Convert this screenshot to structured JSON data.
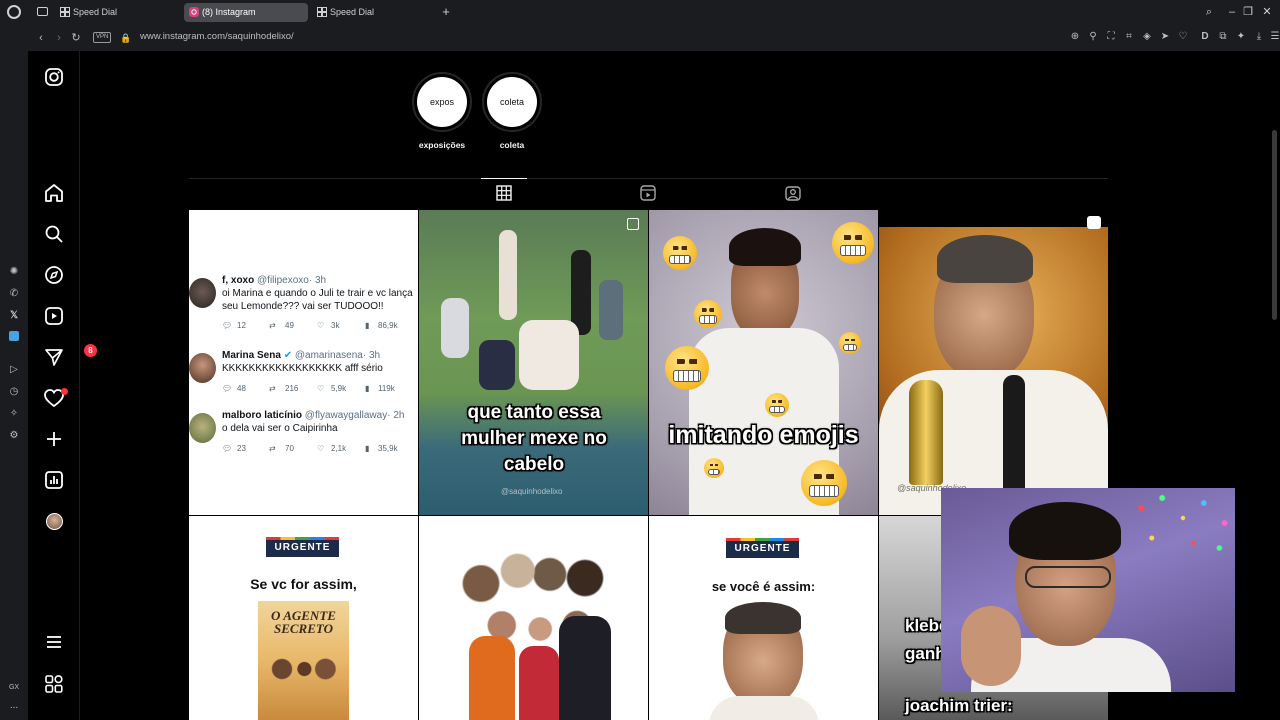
{
  "browser": {
    "tabs": [
      {
        "label": "Speed Dial",
        "active": false
      },
      {
        "label": "(8) Instagram",
        "active": true
      },
      {
        "label": "Speed Dial",
        "active": false
      }
    ],
    "new_tab": "+",
    "url": "www.instagram.com/saquinhodelixo/",
    "vpn_label": "VPN",
    "gx_label": "GX",
    "more_label": "...",
    "accent": "#d0447f"
  },
  "instagram": {
    "nav_badge": "8",
    "highlights": [
      {
        "label": "exposições",
        "cover": "expos"
      },
      {
        "label": "coleta",
        "cover": "coleta"
      }
    ],
    "posts": {
      "tweets": [
        {
          "name": "f, xoxo",
          "handle": "@filipexoxo",
          "time": "· 3h",
          "text": "oi Marina e quando o Juli te trair e vc lança seu Lemonde??? vai ser TUDOOO!!",
          "replies": "12",
          "retweets": "49",
          "likes": "3k",
          "views": "86,9k"
        },
        {
          "name": "Marina Sena",
          "handle": "@amarinasena",
          "time": "· 3h",
          "text": "KKKKKKKKKKKKKKKKKK afff sério",
          "replies": "48",
          "retweets": "216",
          "likes": "5,9k",
          "views": "119k"
        },
        {
          "name": "malboro laticínio",
          "handle": "@flyawaygallaway",
          "time": "· 2h",
          "text": "o dela vai ser o Caipirinha",
          "replies": "23",
          "retweets": "70",
          "likes": "2,1k",
          "views": "35,9k"
        }
      ],
      "post2_caption": "que tanto essa mulher mexe no cabelo",
      "post2_watermark": "@saquinhodelixo",
      "post3_caption": "imitando emojis",
      "post4_watermark": "@saquinhodelixo",
      "urgente": "URGENTE",
      "post5_text": "Se vc for assim,",
      "post5_poster_title": "O AGENTE SECRETO",
      "post7_text": "se você é assim:",
      "post8_line1": "klebe",
      "post8_line2": "ganh",
      "post8_line3": "joachim trier:"
    }
  }
}
